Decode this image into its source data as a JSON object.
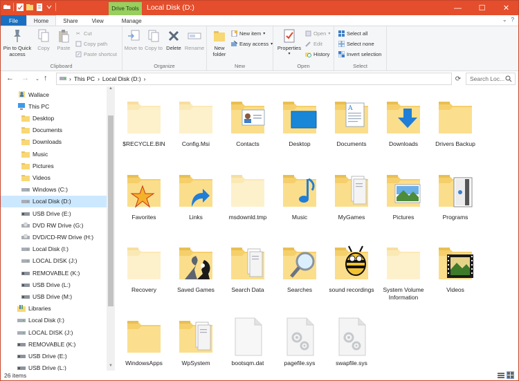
{
  "titlebar": {
    "contextual_tab": "Drive Tools",
    "title": "Local Disk (D:)",
    "minimize": "—",
    "maximize": "☐",
    "close": "✕"
  },
  "tabs": [
    {
      "label": "File"
    },
    {
      "label": "Home"
    },
    {
      "label": "Share"
    },
    {
      "label": "View"
    },
    {
      "label": "Manage"
    }
  ],
  "ribbon": {
    "clipboard": {
      "label": "Clipboard",
      "pin": "Pin to Quick access",
      "copy": "Copy",
      "paste": "Paste",
      "cut": "Cut",
      "copy_path": "Copy path",
      "paste_shortcut": "Paste shortcut"
    },
    "organize": {
      "label": "Organize",
      "move_to": "Move to",
      "copy_to": "Copy to",
      "delete": "Delete",
      "rename": "Rename"
    },
    "new": {
      "label": "New",
      "new_folder": "New folder",
      "new_item": "New item",
      "easy_access": "Easy access"
    },
    "open": {
      "label": "Open",
      "properties": "Properties",
      "open": "Open",
      "edit": "Edit",
      "history": "History"
    },
    "select": {
      "label": "Select",
      "select_all": "Select all",
      "select_none": "Select none",
      "invert": "Invert selection"
    }
  },
  "address": {
    "crumbs": [
      "This PC",
      "Local Disk (D:)"
    ],
    "search_placeholder": "Search Loc..."
  },
  "nav_items": [
    {
      "label": "Wallace",
      "icon": "user-folder-icon",
      "indent": 1
    },
    {
      "label": "This PC",
      "icon": "computer-icon",
      "indent": 1
    },
    {
      "label": "Desktop",
      "icon": "folder-icon",
      "indent": 2
    },
    {
      "label": "Documents",
      "icon": "folder-icon",
      "indent": 2
    },
    {
      "label": "Downloads",
      "icon": "folder-icon",
      "indent": 2
    },
    {
      "label": "Music",
      "icon": "folder-icon",
      "indent": 2
    },
    {
      "label": "Pictures",
      "icon": "folder-icon",
      "indent": 2
    },
    {
      "label": "Videos",
      "icon": "folder-icon",
      "indent": 2
    },
    {
      "label": "Windows (C:)",
      "icon": "drive-icon",
      "indent": 2
    },
    {
      "label": "Local Disk (D:)",
      "icon": "drive-icon",
      "indent": 2,
      "selected": true
    },
    {
      "label": "USB Drive (E:)",
      "icon": "usb-drive-icon",
      "indent": 2
    },
    {
      "label": "DVD RW Drive (G:)",
      "icon": "dvd-drive-icon",
      "indent": 2
    },
    {
      "label": "DVD/CD-RW Drive (H:)",
      "icon": "dvd-drive-icon",
      "indent": 2
    },
    {
      "label": "Local Disk (I:)",
      "icon": "drive-icon",
      "indent": 2
    },
    {
      "label": "LOCAL DISK (J:)",
      "icon": "drive-icon",
      "indent": 2
    },
    {
      "label": "REMOVABLE (K:)",
      "icon": "usb-drive-icon",
      "indent": 2
    },
    {
      "label": "USB Drive (L:)",
      "icon": "usb-drive-icon",
      "indent": 2
    },
    {
      "label": "USB Drive (M:)",
      "icon": "usb-drive-icon",
      "indent": 2
    },
    {
      "label": "Libraries",
      "icon": "library-icon",
      "indent": 1
    },
    {
      "label": "Local Disk (I:)",
      "icon": "drive-icon",
      "indent": 1
    },
    {
      "label": "LOCAL DISK (J:)",
      "icon": "drive-icon",
      "indent": 1
    },
    {
      "label": "REMOVABLE (K:)",
      "icon": "usb-drive-icon",
      "indent": 1
    },
    {
      "label": "USB Drive (E:)",
      "icon": "usb-drive-icon",
      "indent": 1
    },
    {
      "label": "USB Drive (L:)",
      "icon": "usb-drive-icon",
      "indent": 1
    }
  ],
  "items": [
    {
      "label": "$RECYCLE.BIN",
      "kind": "folder-faded",
      "overlay": "none"
    },
    {
      "label": "Config.Msi",
      "kind": "folder-faded",
      "overlay": "none"
    },
    {
      "label": "Contacts",
      "kind": "folder",
      "overlay": "contact-card"
    },
    {
      "label": "Desktop",
      "kind": "folder",
      "overlay": "desktop"
    },
    {
      "label": "Documents",
      "kind": "folder",
      "overlay": "document"
    },
    {
      "label": "Downloads",
      "kind": "folder",
      "overlay": "download-arrow"
    },
    {
      "label": "Drivers Backup",
      "kind": "folder",
      "overlay": "none"
    },
    {
      "label": "Favorites",
      "kind": "folder",
      "overlay": "star"
    },
    {
      "label": "Links",
      "kind": "folder",
      "overlay": "link-arrow"
    },
    {
      "label": "msdownld.tmp",
      "kind": "folder-faded",
      "overlay": "none"
    },
    {
      "label": "Music",
      "kind": "folder",
      "overlay": "music-note"
    },
    {
      "label": "MyGames",
      "kind": "folder",
      "overlay": "papers"
    },
    {
      "label": "Pictures",
      "kind": "folder",
      "overlay": "landscape"
    },
    {
      "label": "Programs",
      "kind": "folder",
      "overlay": "film"
    },
    {
      "label": "Recovery",
      "kind": "folder-faded",
      "overlay": "none"
    },
    {
      "label": "Saved Games",
      "kind": "folder",
      "overlay": "chess"
    },
    {
      "label": "Search Data",
      "kind": "folder",
      "overlay": "papers"
    },
    {
      "label": "Searches",
      "kind": "folder",
      "overlay": "magnifier"
    },
    {
      "label": "sound recordings",
      "kind": "folder",
      "overlay": "bee"
    },
    {
      "label": "System Volume Information",
      "kind": "folder-faded",
      "overlay": "none"
    },
    {
      "label": "Videos",
      "kind": "folder",
      "overlay": "filmstrip"
    },
    {
      "label": "WindowsApps",
      "kind": "folder",
      "overlay": "none"
    },
    {
      "label": "WpSystem",
      "kind": "folder",
      "overlay": "papers"
    },
    {
      "label": "bootsqm.dat",
      "kind": "file",
      "overlay": "none"
    },
    {
      "label": "pagefile.sys",
      "kind": "sysfile",
      "overlay": "gears"
    },
    {
      "label": "swapfile.sys",
      "kind": "sysfile",
      "overlay": "gears"
    }
  ],
  "status": {
    "count": "26 items"
  },
  "colors": {
    "titlebar": "#e44e2c",
    "drive_tools": "#98cf5f",
    "file_tab": "#1a6fc0",
    "selection": "#cce8ff",
    "folder": "#f8d775"
  }
}
